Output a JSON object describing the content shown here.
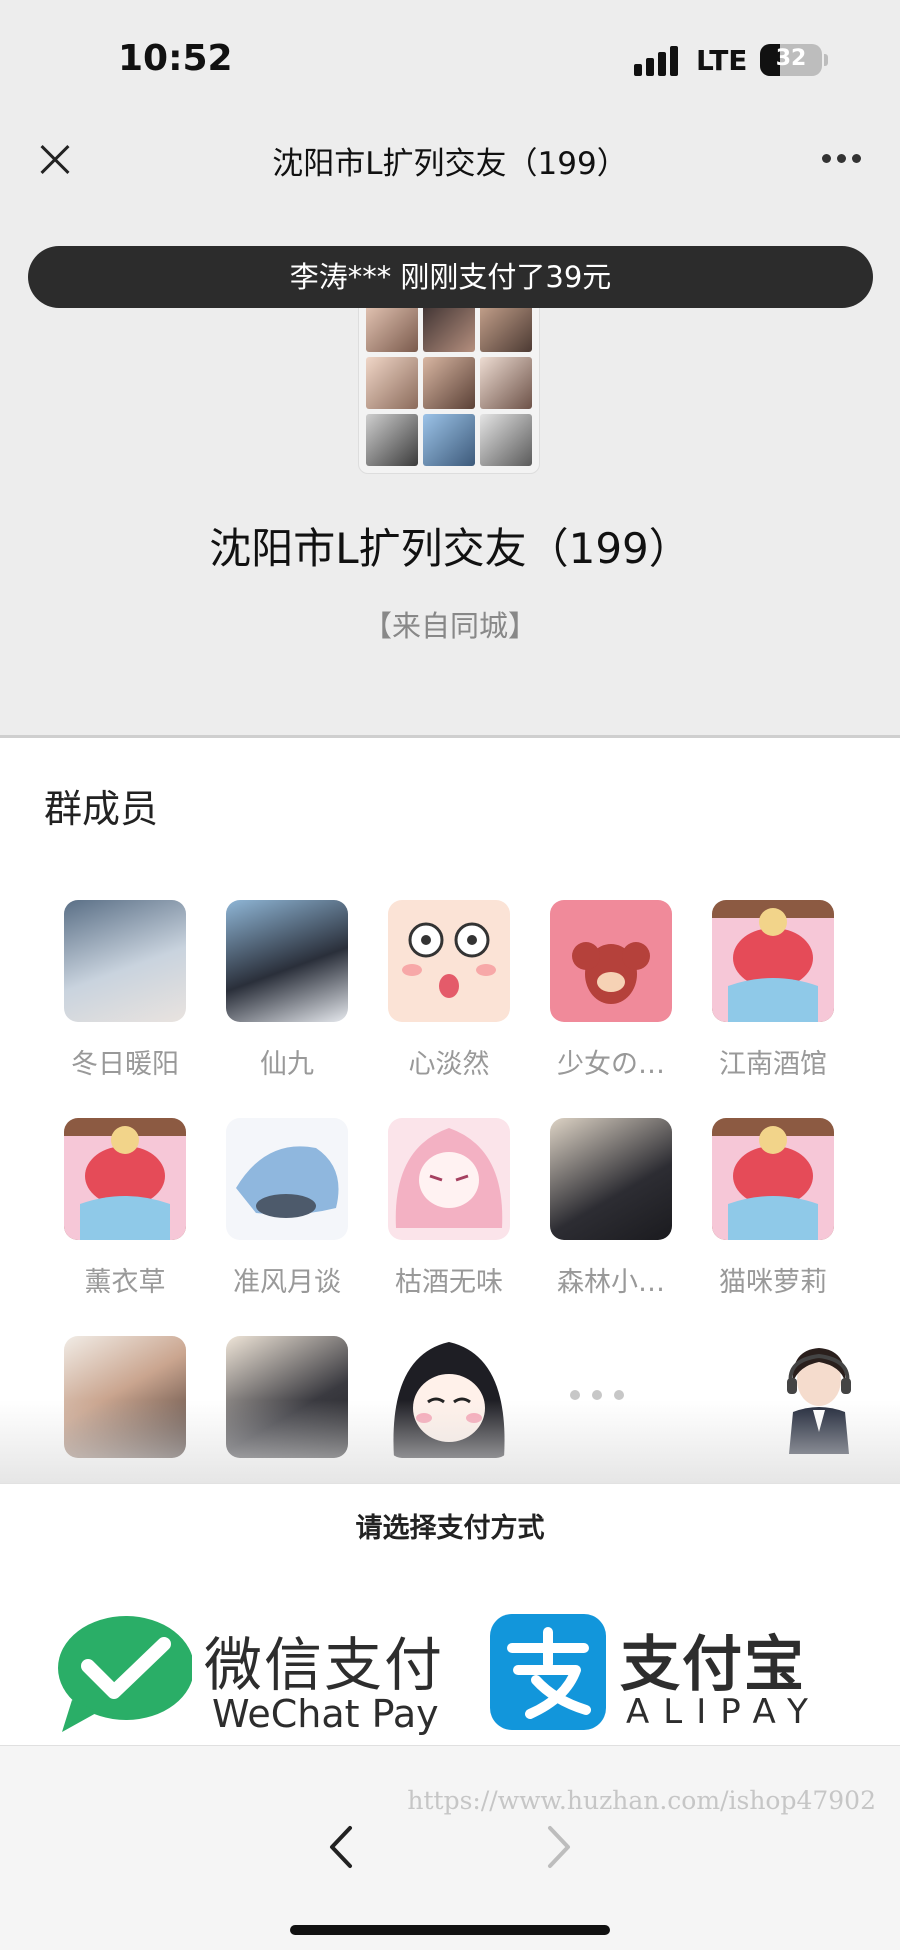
{
  "status_bar": {
    "time": "10:52",
    "network": "LTE",
    "battery": "32"
  },
  "nav": {
    "title": "沈阳市L扩列交友（199）"
  },
  "toast": {
    "text": "李涛*** 刚刚支付了39元"
  },
  "group": {
    "title": "沈阳市L扩列交友（199）",
    "subtitle": "【来自同城】"
  },
  "members": {
    "title": "群成员",
    "items": [
      {
        "name": "冬日暖阳"
      },
      {
        "name": "仙九"
      },
      {
        "name": "心淡然"
      },
      {
        "name": "少女の…"
      },
      {
        "name": "江南酒馆"
      },
      {
        "name": "薰衣草"
      },
      {
        "name": "准风月谈"
      },
      {
        "name": "枯酒无味"
      },
      {
        "name": "森林小…"
      },
      {
        "name": "猫咪萝莉"
      }
    ]
  },
  "payment": {
    "title": "请选择支付方式",
    "wechat_cn": "微信支付",
    "wechat_en": "WeChat Pay",
    "alipay_cn": "支付宝",
    "alipay_en": "ALIPAY"
  },
  "watermark": "https://www.huzhan.com/ishop47902",
  "colors": {
    "wechat_green": "#2aae67",
    "alipay_blue": "#1296db",
    "toast_bg": "#2c2c2c"
  }
}
